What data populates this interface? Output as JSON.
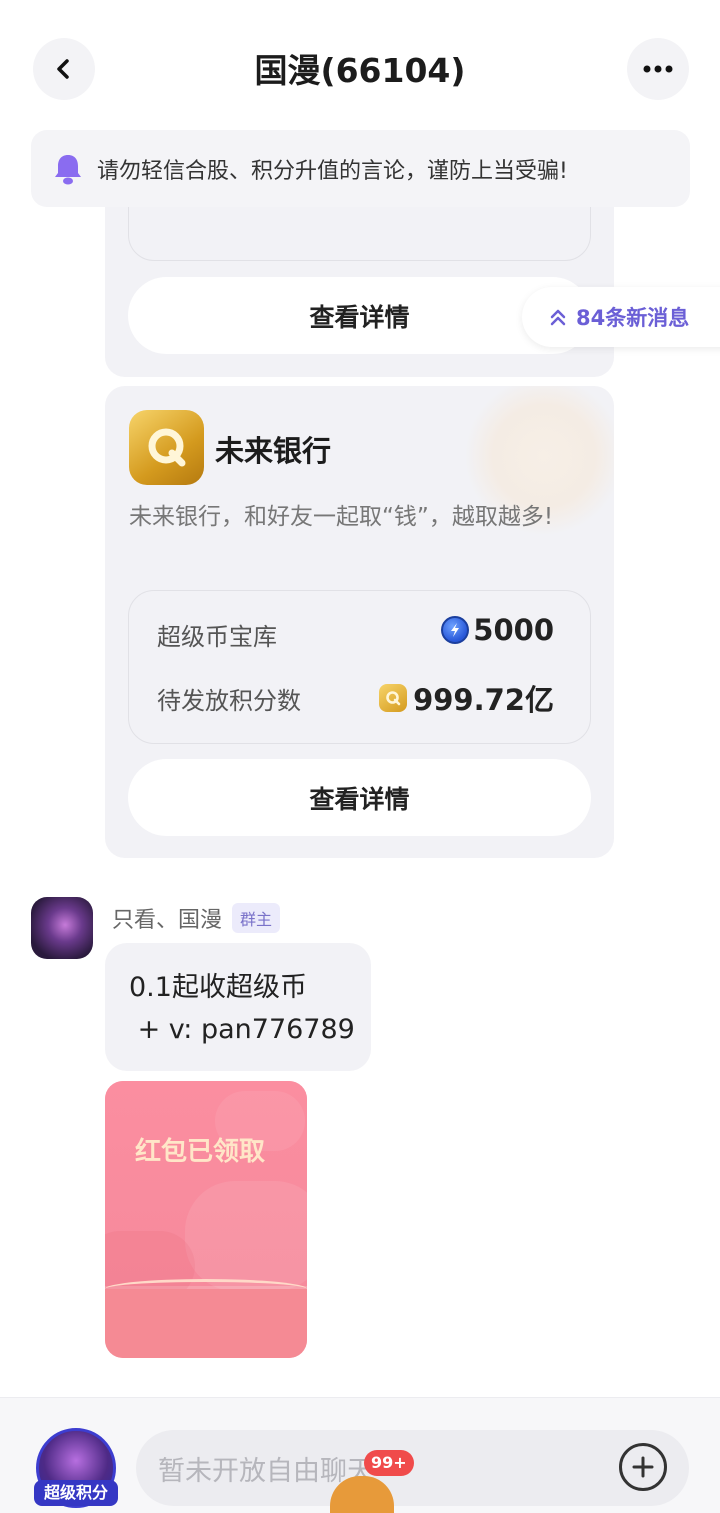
{
  "header": {
    "title": "国漫(66104)"
  },
  "notice": {
    "text": "请勿轻信合股、积分升值的言论，谨防上当受骗!"
  },
  "new_messages": {
    "label": "84条新消息"
  },
  "card1": {
    "button_label": "查看详情"
  },
  "card2": {
    "title": "未来银行",
    "description": "未来银行，和好友一起取“钱”，越取越多!",
    "rows": [
      {
        "label": "超级币宝库",
        "value": "5000",
        "icon": "super-coin-icon"
      },
      {
        "label": "待发放积分数",
        "value": "999.72亿",
        "icon": "q-points-icon"
      }
    ],
    "button_label": "查看详情"
  },
  "message": {
    "sender": "只看、国漫",
    "role_badge": "群主",
    "line1": "0.1起收超级币",
    "line2": " + v: pan776789"
  },
  "red_packet": {
    "status": "红包已领取"
  },
  "bottom": {
    "super_points_label": "超级积分",
    "input_placeholder": "暂未开放自由聊天",
    "badge_count": "99+"
  },
  "colors": {
    "accent": "#6b5fd6",
    "card_bg": "#f2f2f6",
    "red_packet": "#f68a9c",
    "badge_red": "#f04b4b"
  }
}
